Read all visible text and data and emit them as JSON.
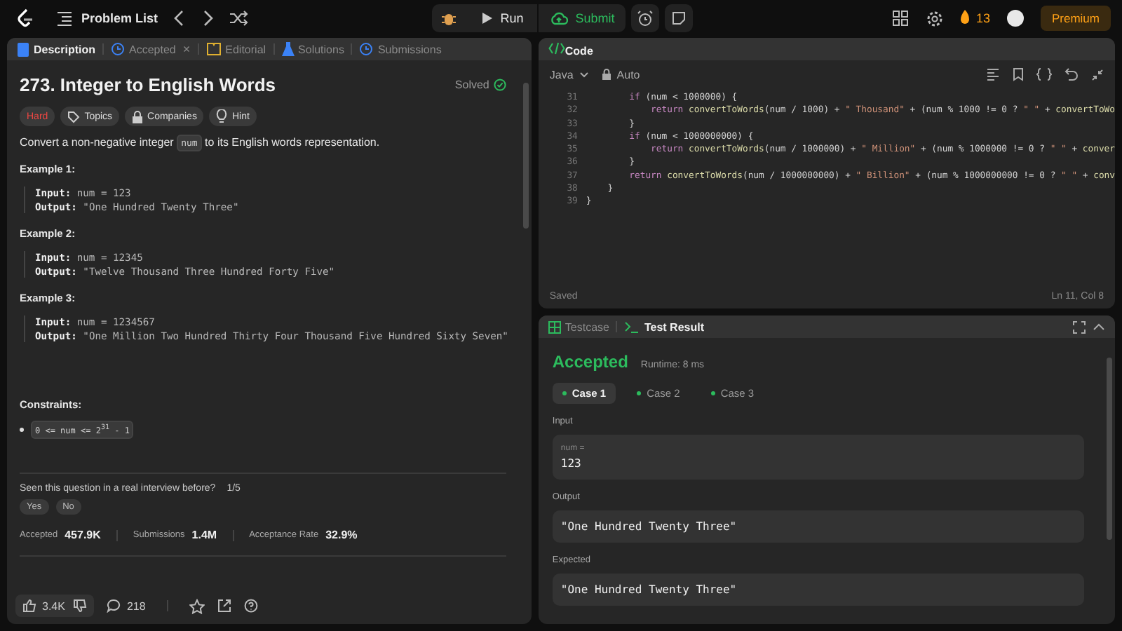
{
  "topbar": {
    "problem_list": "Problem List",
    "run": "Run",
    "submit": "Submit",
    "streak": "13",
    "premium": "Premium"
  },
  "description_tabs": [
    {
      "label": "Description",
      "kind": "doc",
      "selected": true
    },
    {
      "label": "Accepted",
      "kind": "clock",
      "selected": false,
      "close": "×"
    },
    {
      "label": "Editorial",
      "kind": "book",
      "selected": false
    },
    {
      "label": "Solutions",
      "kind": "flask",
      "selected": false
    },
    {
      "label": "Submissions",
      "kind": "clock",
      "selected": false
    }
  ],
  "problem": {
    "title": "273. Integer to English Words",
    "status": "Solved",
    "difficulty": "Hard",
    "tags": [
      {
        "label": "Topics",
        "kind": "tag"
      },
      {
        "label": "Companies",
        "kind": "lock"
      },
      {
        "label": "Hint",
        "kind": "bulb"
      }
    ],
    "statement_before": "Convert a non-negative integer",
    "statement_code": "num",
    "statement_after": "to its English words representation.",
    "examples": [
      {
        "title": "Example 1:",
        "input_label": "Input:",
        "input": "num = 123",
        "output_label": "Output:",
        "output": "\"One Hundred Twenty Three\""
      },
      {
        "title": "Example 2:",
        "input_label": "Input:",
        "input": "num = 12345",
        "output_label": "Output:",
        "output": "\"Twelve Thousand Three Hundred Forty Five\""
      },
      {
        "title": "Example 3:",
        "input_label": "Input:",
        "input": "num = 1234567",
        "output_label": "Output:",
        "output": "\"One Million Two Hundred Thirty Four Thousand Five Hundred Sixty Seven\""
      }
    ],
    "constraints_title": "Constraints:",
    "constraints": [
      "0 <= num <= 2$^{31}$ - 1"
    ],
    "interview_question": "Seen this question in a real interview before?",
    "interview_count": "1/5",
    "answers": [
      "Yes",
      "No"
    ],
    "stats": [
      {
        "label": "Accepted",
        "value": "457.9K"
      },
      {
        "label": "Submissions",
        "value": "1.4M"
      },
      {
        "label": "Acceptance Rate",
        "value": "32.9%"
      }
    ],
    "likes": "3.4K",
    "comments": "218"
  },
  "code": {
    "title": "Code",
    "language": "Java",
    "mode": "Auto",
    "status": "Saved",
    "cursor": "Ln 11, Col 8",
    "lines": [
      {
        "number": "31",
        "tokens": [
          {
            "kind": "kw",
            "text": "        if"
          },
          {
            "kind": "plain",
            "text": " (num < 1000000) {"
          }
        ]
      },
      {
        "number": "32",
        "tokens": [
          {
            "kind": "kw",
            "text": "            return"
          },
          {
            "kind": "fn",
            "text": " convertToWords"
          },
          {
            "kind": "plain",
            "text": "(num / 1000) + "
          },
          {
            "kind": "str",
            "text": "\" Thousand\""
          },
          {
            "kind": "plain",
            "text": " + (num % 1000 != 0 ? "
          },
          {
            "kind": "str",
            "text": "\" \""
          },
          {
            "kind": "plain",
            "text": " + "
          },
          {
            "kind": "fn",
            "text": "convertToWo"
          }
        ]
      },
      {
        "number": "33",
        "tokens": [
          {
            "kind": "plain",
            "text": "        }"
          }
        ]
      },
      {
        "number": "34",
        "tokens": [
          {
            "kind": "kw",
            "text": "        if"
          },
          {
            "kind": "plain",
            "text": " (num < 1000000000) {"
          }
        ]
      },
      {
        "number": "35",
        "tokens": [
          {
            "kind": "kw",
            "text": "            return"
          },
          {
            "kind": "fn",
            "text": " convertToWords"
          },
          {
            "kind": "plain",
            "text": "(num / 1000000) + "
          },
          {
            "kind": "str",
            "text": "\" Million\""
          },
          {
            "kind": "plain",
            "text": " + (num % 1000000 != 0 ? "
          },
          {
            "kind": "str",
            "text": "\" \""
          },
          {
            "kind": "plain",
            "text": " + "
          },
          {
            "kind": "fn",
            "text": "conver"
          }
        ]
      },
      {
        "number": "36",
        "tokens": [
          {
            "kind": "plain",
            "text": "        }"
          }
        ]
      },
      {
        "number": "37",
        "tokens": [
          {
            "kind": "kw",
            "text": "        return"
          },
          {
            "kind": "fn",
            "text": " convertToWords"
          },
          {
            "kind": "plain",
            "text": "(num / 1000000000) + "
          },
          {
            "kind": "str",
            "text": "\" Billion\""
          },
          {
            "kind": "plain",
            "text": " + (num % 1000000000 != 0 ? "
          },
          {
            "kind": "str",
            "text": "\" \""
          },
          {
            "kind": "plain",
            "text": " + "
          },
          {
            "kind": "fn",
            "text": "conv"
          }
        ]
      },
      {
        "number": "38",
        "tokens": [
          {
            "kind": "plain",
            "text": "    }"
          }
        ]
      },
      {
        "number": "39",
        "tokens": [
          {
            "kind": "plain",
            "text": "}"
          }
        ]
      }
    ]
  },
  "result_tabs": [
    {
      "label": "Testcase",
      "selected": false
    },
    {
      "label": "Test Result",
      "selected": true
    }
  ],
  "result": {
    "verdict": "Accepted",
    "runtime": "Runtime: 8 ms",
    "cases": [
      {
        "label": "Case 1",
        "selected": true
      },
      {
        "label": "Case 2",
        "selected": false
      },
      {
        "label": "Case 3",
        "selected": false
      }
    ],
    "input_title": "Input",
    "input_name": "num =",
    "input_value": "123",
    "output_title": "Output",
    "output_value": "\"One Hundred Twenty Three\"",
    "expected_title": "Expected",
    "expected_value": "\"One Hundred Twenty Three\""
  }
}
